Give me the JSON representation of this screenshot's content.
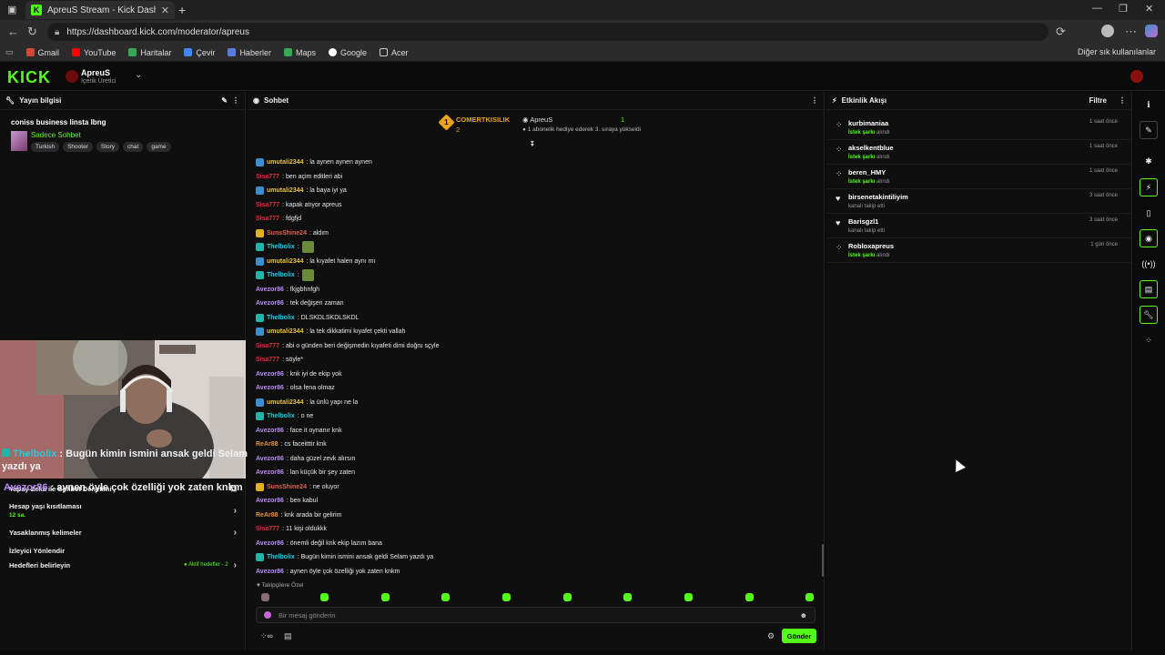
{
  "browser": {
    "tab_title": "ApreuS Stream - Kick Dashboard",
    "url": "https://dashboard.kick.com/moderator/apreus",
    "bookmarks": [
      "Gmail",
      "YouTube",
      "Haritalar",
      "Çevir",
      "Haberler",
      "Maps",
      "Google",
      "Acer"
    ],
    "bookmarks_right": "Diğer sık kullanılanlar"
  },
  "header": {
    "logo": "KICK",
    "channel_name": "ApreuS",
    "channel_role": "İçerik Üretici"
  },
  "stream_info": {
    "panel_title": "Yayın bilgisi",
    "title": "coniss business linsta lbng",
    "category": "Sadece Sohbet",
    "tags": [
      "Turkish",
      "Shooter",
      "Story",
      "chat",
      "game"
    ]
  },
  "left_sections": [
    {
      "label": "Yapay Zeka ile Sohbet Denetimi",
      "sub": "",
      "icon": "external-link-icon"
    },
    {
      "label": "Hesap yaşı kısıtlaması",
      "sub": "12 sa.",
      "icon": "chevron-right-icon"
    },
    {
      "label": "Yasaklanmış kelimeler",
      "sub": "",
      "icon": "chevron-right-icon"
    },
    {
      "label": "İzleyici Yönlendir",
      "sub": "",
      "icon": ""
    },
    {
      "label": "Hedefleri belirleyin",
      "sub": "",
      "badge": "● Aktif hedefler - 2",
      "icon": "chevron-right-icon"
    }
  ],
  "overlay": {
    "line1_user": "Thelbolix",
    "line1_text": " : Bugün kimin ismini ansak geldi Selam yazdı ya",
    "line2_user": "Avezor86",
    "line2_text": " : aynen öyle çok özelliği yok zaten knkm"
  },
  "chat": {
    "panel_title": "Sohbet",
    "pinned": {
      "gifter": "COMERTKISILIK",
      "gifter_count": "2",
      "recipient": "ApreuS",
      "text": "1 abonelik hediye ederek 3. sıraya yükseldi",
      "count": "1"
    },
    "messages": [
      {
        "user": "umutali2344",
        "color": "#e8c04a",
        "badge": "sub",
        "text": ": la aynen aynen aynen"
      },
      {
        "user": "Sisa777",
        "color": "#d1343f",
        "badge": "",
        "text": ": ben açim editleri abi"
      },
      {
        "user": "umutali2344",
        "color": "#e8c04a",
        "badge": "sub",
        "text": ": la baya iyi ya"
      },
      {
        "user": "Sisa777",
        "color": "#d1343f",
        "badge": "",
        "text": ": kapak atıyor apreus"
      },
      {
        "user": "Sisa777",
        "color": "#d1343f",
        "badge": "",
        "text": ": fdgfjd"
      },
      {
        "user": "SunsShine24",
        "color": "#e0604a",
        "badge": "crown",
        "text": ": aldım"
      },
      {
        "user": "Thelbolix",
        "color": "#30c6d9",
        "badge": "mod",
        "text": ":",
        "emote": true
      },
      {
        "user": "umutali2344",
        "color": "#e8c04a",
        "badge": "sub",
        "text": ": la kıyafet halen aynı mı"
      },
      {
        "user": "Thelbolix",
        "color": "#30c6d9",
        "badge": "mod",
        "text": ":",
        "emote": true
      },
      {
        "user": "Avezor86",
        "color": "#b88df5",
        "badge": "",
        "text": ": fkjgbhnfgh"
      },
      {
        "user": "Avezor86",
        "color": "#b88df5",
        "badge": "",
        "text": ": tek değişen zaman"
      },
      {
        "user": "Thelbolix",
        "color": "#30c6d9",
        "badge": "mod",
        "text": ": DLSKDLSKDLSKDL"
      },
      {
        "user": "umutali2344",
        "color": "#e8c04a",
        "badge": "sub",
        "text": ": la tek dikkatimi kıyafet çekti vallah"
      },
      {
        "user": "Sisa777",
        "color": "#d1343f",
        "badge": "",
        "text": ": abi o günden beri değişmedin kıyafeti dimi doğru sçyle"
      },
      {
        "user": "Sisa777",
        "color": "#d1343f",
        "badge": "",
        "text": ": söyle*"
      },
      {
        "user": "Avezor86",
        "color": "#b88df5",
        "badge": "",
        "text": ": knk iyi de ekip yok"
      },
      {
        "user": "Avezor86",
        "color": "#b88df5",
        "badge": "",
        "text": ": olsa fena olmaz"
      },
      {
        "user": "umutali2344",
        "color": "#e8c04a",
        "badge": "sub",
        "text": ": la ünlü yapı ne la"
      },
      {
        "user": "Thelbolix",
        "color": "#30c6d9",
        "badge": "mod",
        "text": ": o ne"
      },
      {
        "user": "Avezor86",
        "color": "#b88df5",
        "badge": "",
        "text": ": face it oynanır knk"
      },
      {
        "user": "ReAr88",
        "color": "#e8923a",
        "badge": "",
        "text": ": cs faceitttir knk"
      },
      {
        "user": "Avezor86",
        "color": "#b88df5",
        "badge": "",
        "text": ": daha güzel zevk alırsın"
      },
      {
        "user": "Avezor86",
        "color": "#b88df5",
        "badge": "",
        "text": ": lan küçük bir şey zaten"
      },
      {
        "user": "SunsShine24",
        "color": "#e0604a",
        "badge": "crown",
        "text": ": ne oluyor"
      },
      {
        "user": "Avezor86",
        "color": "#b88df5",
        "badge": "",
        "text": ": ben kabul"
      },
      {
        "user": "ReAr88",
        "color": "#e8923a",
        "badge": "",
        "text": ": knk arada bir gelirim"
      },
      {
        "user": "Sisa777",
        "color": "#d1343f",
        "badge": "",
        "text": ": 11 kişi oldukkk"
      },
      {
        "user": "Avezor86",
        "color": "#b88df5",
        "badge": "",
        "text": ": önemli değil knk ekip lazım bana"
      },
      {
        "user": "Thelbolix",
        "color": "#30c6d9",
        "badge": "mod",
        "text": ": Bugün kimin ismini ansak geldi Selam yazdı ya"
      },
      {
        "user": "Avezor86",
        "color": "#b88df5",
        "badge": "",
        "text": ": aynen öyle çok özelliği yok zaten knkm"
      }
    ],
    "followers_only": "♥ Takipçilere Özel",
    "input_placeholder": "Bir mesaj gönderin",
    "send_label": "Gönder"
  },
  "activity": {
    "panel_title": "Etkinlik Akışı",
    "filter_label": "Filtre",
    "items": [
      {
        "name": "kurbimaniaa",
        "desc_pre": "",
        "desc_hl": "İstek şarkı",
        "desc_post": " alındı",
        "time": "1 saat önce",
        "icon": "song-icon"
      },
      {
        "name": "akselkentblue",
        "desc_pre": "",
        "desc_hl": "İstek şarkı",
        "desc_post": " alındı",
        "time": "1 saat önce",
        "icon": "song-icon"
      },
      {
        "name": "beren_HMY",
        "desc_pre": "",
        "desc_hl": "İstek şarkı",
        "desc_post": " alındı",
        "time": "1 saat önce",
        "icon": "song-icon"
      },
      {
        "name": "birsenetakintiliyim",
        "desc_pre": "kanalı takip etti",
        "desc_hl": "",
        "desc_post": "",
        "time": "3 saat önce",
        "icon": "heart-icon"
      },
      {
        "name": "Barisgzl1",
        "desc_pre": "kanalı takip etti",
        "desc_hl": "",
        "desc_post": "",
        "time": "3 saat önce",
        "icon": "heart-icon"
      },
      {
        "name": "Robloxapreus",
        "desc_pre": "",
        "desc_hl": "İstek şarkı",
        "desc_post": " alındı",
        "time": "1 gün önce",
        "icon": "song-icon"
      }
    ]
  }
}
